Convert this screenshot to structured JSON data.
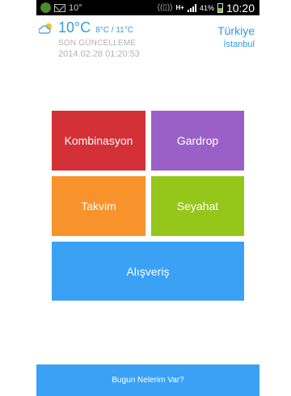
{
  "status_bar": {
    "temperature": "10°",
    "network": "H+",
    "battery_percent": "41%",
    "battery_level": 0.41,
    "time": "10:20"
  },
  "weather": {
    "icon": "partly-cloudy-icon",
    "temperature": "10°C",
    "range": "8°C / 11°C",
    "updated_label": "SON GÜNCELLEME",
    "updated_time": "2014.02.28 01:20:53"
  },
  "location": {
    "country": "Türkiye",
    "city": "İstanbul"
  },
  "tiles": {
    "kombinasyon": {
      "label": "Kombinasyon",
      "color": "#d43038"
    },
    "gardrop": {
      "label": "Gardrop",
      "color": "#9a60c8"
    },
    "takvim": {
      "label": "Takvim",
      "color": "#f8922a"
    },
    "seyahat": {
      "label": "Seyahat",
      "color": "#95c61a"
    },
    "alisveris": {
      "label": "Alışveriş",
      "color": "#3aa1f5"
    }
  },
  "bottom_button": {
    "label": "Bugun Nelerim Var?",
    "color": "#3aa1f5"
  },
  "accent_color": "#3a9ad9"
}
